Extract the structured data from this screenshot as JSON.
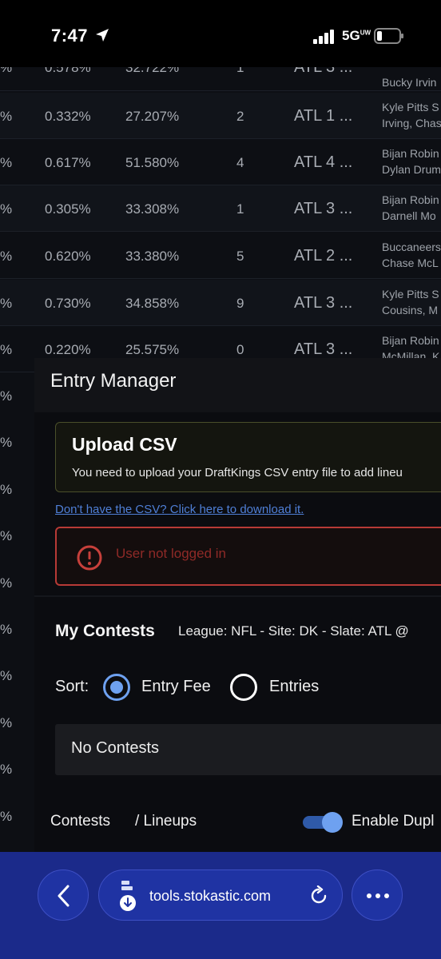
{
  "status": {
    "time": "7:47",
    "network": "5G",
    "network_sup": "UW"
  },
  "table_rows": [
    {
      "c0": "%",
      "c1": "0.578%",
      "c2": "32.722%",
      "c3": "1",
      "c4": "ATL 3 ...",
      "c5a": "",
      "c5b": "Bucky Irvin"
    },
    {
      "c0": "%",
      "c1": "0.332%",
      "c2": "27.207%",
      "c3": "2",
      "c4": "ATL 1 ...",
      "c5a": "Kyle Pitts S",
      "c5b": "Irving, Chas"
    },
    {
      "c0": "%",
      "c1": "0.617%",
      "c2": "51.580%",
      "c3": "4",
      "c4": "ATL 4 ...",
      "c5a": "Bijan Robin",
      "c5b": "Dylan Drum"
    },
    {
      "c0": "%",
      "c1": "0.305%",
      "c2": "33.308%",
      "c3": "1",
      "c4": "ATL 3 ...",
      "c5a": "Bijan Robin",
      "c5b": "Darnell Mo"
    },
    {
      "c0": "%",
      "c1": "0.620%",
      "c2": "33.380%",
      "c3": "5",
      "c4": "ATL 2 ...",
      "c5a": "Buccaneers",
      "c5b": "Chase McL"
    },
    {
      "c0": "%",
      "c1": "0.730%",
      "c2": "34.858%",
      "c3": "9",
      "c4": "ATL 3 ...",
      "c5a": "Kyle Pitts S",
      "c5b": "Cousins, M"
    },
    {
      "c0": "%",
      "c1": "0.220%",
      "c2": "25.575%",
      "c3": "0",
      "c4": "ATL 3 ...",
      "c5a": "Bijan Robin",
      "c5b": "McMillan, K"
    }
  ],
  "side_pcts": [
    "%",
    "%",
    "%",
    "%",
    "%",
    "%",
    "%",
    "%",
    "%",
    "%"
  ],
  "entry_manager": {
    "title": "Entry Manager",
    "upload_title": "Upload CSV",
    "upload_desc": "You need to upload your DraftKings CSV entry file to add lineu",
    "csv_link": "Don't have the CSV? Click here to download it.",
    "alert_text": "User not logged in"
  },
  "contests": {
    "title": "My Contests",
    "info": "League: NFL - Site: DK - Slate: ATL @",
    "sort_label": "Sort:",
    "sort_options": [
      "Entry Fee",
      "Entries"
    ],
    "sort_selected": "Entry Fee",
    "empty_text": "No Contests",
    "tab_contests": "Contests",
    "tab_lineups": "/ Lineups",
    "toggle_label": "Enable Dupl",
    "toggle_on": true
  },
  "browser": {
    "url": "tools.stokastic.com"
  },
  "colors": {
    "accent": "#6ea1f0",
    "link": "#4f7fd6",
    "error": "#b73a36",
    "browser_bar": "#1b2a8a"
  }
}
